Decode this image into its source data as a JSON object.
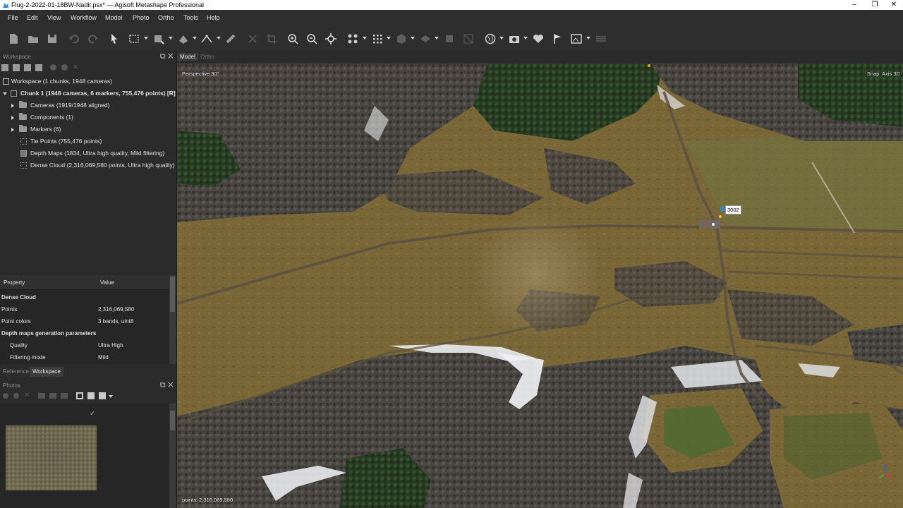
{
  "window": {
    "title": "Flug-2-2022-01-18BW-Nadir.psx* — Agisoft Metashape Professional",
    "controls": [
      "–",
      "❐",
      "✕"
    ]
  },
  "menu": [
    "File",
    "Edit",
    "View",
    "Workflow",
    "Model",
    "Photo",
    "Ortho",
    "Tools",
    "Help"
  ],
  "workspace": {
    "header": "Workspace",
    "root": "Workspace (1 chunks, 1948 cameras)",
    "chunk": "Chunk 1 (1948 cameras, 6 markers, 755,476 points) [R]",
    "items": [
      "Cameras (1919/1948 aligned)",
      "Components (1)",
      "Markers (6)",
      "Tie Points (755,476 points)",
      "Depth Maps (1834, Ultra high quality, Mild filtering)",
      "Dense Cloud (2,316,069,580 points, Ultra high quality)"
    ]
  },
  "properties": {
    "col_property": "Property",
    "col_value": "Value",
    "rows": [
      {
        "k": "Dense Cloud",
        "v": ""
      },
      {
        "k": "Points",
        "v": "2,316,069,580"
      },
      {
        "k": "Point colors",
        "v": "3 bands, uint8"
      },
      {
        "k": "Depth maps generation parameters",
        "v": ""
      },
      {
        "k": "Quality",
        "v": "Ultra High"
      },
      {
        "k": "Filtering mode",
        "v": "Mild"
      }
    ]
  },
  "bottom_tabs": [
    "Reference",
    "Workspace"
  ],
  "photos": {
    "header": "Photos",
    "check": "✓"
  },
  "view": {
    "tabs": [
      "Model",
      "Ortho"
    ],
    "perspective": "Perspective 30°",
    "snap": "Snap: Axis 3D",
    "points_status": "points: 2,316,069,580",
    "marker_label": "3002"
  },
  "colors": {
    "accent_marker": "#2f86d4",
    "background": "#2b2b2b"
  }
}
